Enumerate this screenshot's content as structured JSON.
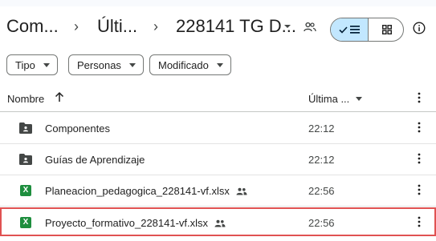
{
  "breadcrumb": {
    "items": [
      "Com...",
      "Últi...",
      "228141 TG D..."
    ],
    "separator": "›"
  },
  "icons": {
    "shared": "people-icon",
    "list_view": "list-view-icon",
    "grid_view": "grid-view-icon",
    "info": "info-icon",
    "sort_up": "arrow-up-icon",
    "more": "more-vert-icon",
    "folder": "shared-folder-icon",
    "spreadsheet": "excel-icon"
  },
  "filters": {
    "chips": [
      "Tipo",
      "Personas",
      "Modificado"
    ]
  },
  "table": {
    "col_name": "Nombre",
    "col_modified": "Última ...",
    "rows": [
      {
        "name": "Componentes",
        "time": "22:12",
        "type": "folder",
        "shared": false
      },
      {
        "name": "Guías de Aprendizaje",
        "time": "22:12",
        "type": "folder",
        "shared": false
      },
      {
        "name": "Planeacion_pedagogica_228141-vf.xlsx",
        "time": "22:56",
        "type": "xlsx",
        "shared": true
      },
      {
        "name": "Proyecto_formativo_228141-vf.xlsx",
        "time": "22:56",
        "type": "xlsx",
        "shared": true,
        "selected": true
      }
    ]
  },
  "excel_badge": "X",
  "colors": {
    "view_toggle_active": "#c2e7ff",
    "excel_green": "#1e8e3e",
    "selection_border": "#e05252"
  }
}
